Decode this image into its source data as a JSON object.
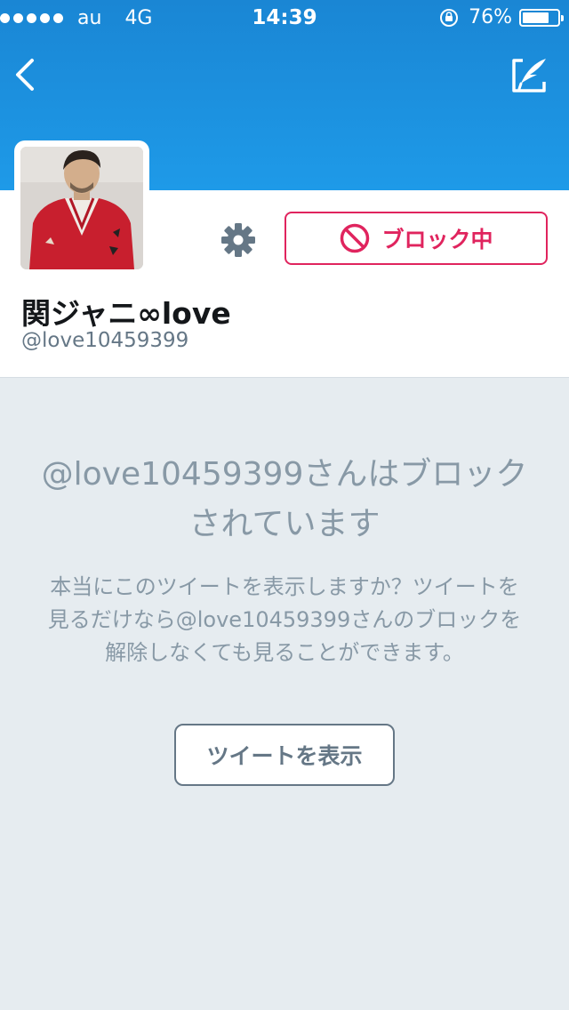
{
  "status_bar": {
    "carrier": "au",
    "network": "4G",
    "time": "14:39",
    "battery_percent": "76%",
    "battery_level": 0.76,
    "signal_icon": "signal-dots-icon",
    "rotation_lock_icon": "rotation-lock-icon"
  },
  "nav": {
    "back_icon": "chevron-left-icon",
    "compose_icon": "compose-tweet-icon"
  },
  "profile": {
    "display_name": "関ジャニ∞love",
    "screen_name": "@love10459399",
    "avatar_icon": "profile-photo",
    "settings_icon": "gear-icon",
    "block_button_label": "ブロック中",
    "block_icon": "block-circle-icon"
  },
  "blocked_notice": {
    "title": "@love10459399さんはブロックされています",
    "description": "本当にこのツイートを表示しますか？ツイートを見るだけなら@love10459399さんのブロックを解除しなくても見ることができます。",
    "show_button_label": "ツイートを表示"
  },
  "colors": {
    "header_blue": "#1d91e0",
    "block_red": "#e0245e",
    "muted_text": "#8899a6",
    "background": "#e6ecf0"
  }
}
